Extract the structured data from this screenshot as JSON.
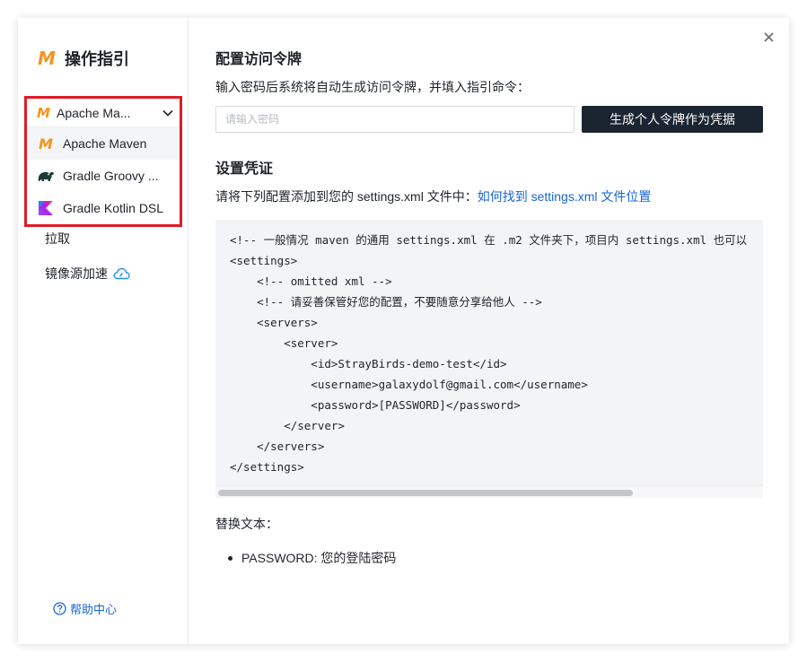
{
  "sidebar": {
    "title": "操作指引",
    "logo_letter": "M",
    "selected": "Apache Ma...",
    "options": [
      {
        "label": "Apache Maven",
        "icon": "maven-icon"
      },
      {
        "label": "Gradle Groovy ...",
        "icon": "gradle-elephant-icon"
      },
      {
        "label": "Gradle Kotlin DSL",
        "icon": "kotlin-icon"
      }
    ],
    "nav": [
      {
        "label": "拉取"
      },
      {
        "label": "镜像源加速",
        "icon": "cloud-icon"
      }
    ],
    "help": "帮助中心"
  },
  "main": {
    "token_title": "配置访问令牌",
    "token_desc": "输入密码后系统将自动生成访问令牌，并填入指引命令：",
    "password_placeholder": "请输入密码",
    "generate_button": "生成个人令牌作为凭据",
    "cred_title": "设置凭证",
    "cred_desc": "请将下列配置添加到您的 settings.xml 文件中：",
    "cred_link": "如何找到 settings.xml 文件位置",
    "code_lines": [
      "<!-- 一般情况 maven 的通用 settings.xml 在 .m2 文件夹下，项目内 settings.xml 也可以",
      "<settings>",
      "    <!-- omitted xml -->",
      "    <!-- 请妥善保管好您的配置，不要随意分享给他人 -->",
      "    <servers>",
      "        <server>",
      "            <id>StrayBirds-demo-test</id>",
      "            <username>galaxydolf@gmail.com</username>",
      "            <password>[PASSWORD]</password>",
      "        </server>",
      "    </servers>",
      "</settings>"
    ],
    "replace_title": "替换文本：",
    "replace_items": [
      "PASSWORD: 您的登陆密码"
    ]
  },
  "colors": {
    "accent": "#1765d9",
    "maven_orange": "#f7931e",
    "highlight_red": "#e01b24",
    "button_dark": "#1b2532"
  }
}
